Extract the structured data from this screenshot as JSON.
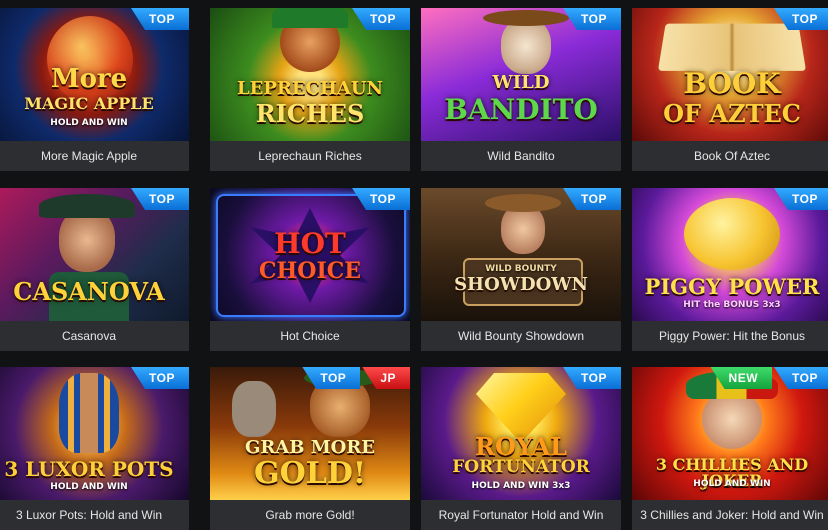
{
  "games": [
    {
      "name": "More Magic Apple",
      "art_lines": [
        "More",
        "MAGIC APPLE"
      ],
      "art_sub": "HOLD AND WIN",
      "badges": [
        {
          "label": "TOP",
          "type": "top"
        }
      ]
    },
    {
      "name": "Leprechaun Riches",
      "art_lines": [
        "LEPRECHAUN",
        "RICHES"
      ],
      "art_sub": "",
      "badges": [
        {
          "label": "TOP",
          "type": "top"
        }
      ]
    },
    {
      "name": "Wild Bandito",
      "art_lines": [
        "WILD",
        "BANDITO"
      ],
      "art_sub": "",
      "badges": [
        {
          "label": "TOP",
          "type": "top"
        }
      ]
    },
    {
      "name": "Book Of Aztec",
      "art_lines": [
        "BOOK",
        "OF AZTEC"
      ],
      "art_sub": "",
      "badges": [
        {
          "label": "TOP",
          "type": "top"
        }
      ]
    },
    {
      "name": "Casanova",
      "art_lines": [
        "CASANOVA"
      ],
      "art_sub": "",
      "badges": [
        {
          "label": "TOP",
          "type": "top"
        }
      ]
    },
    {
      "name": "Hot Choice",
      "art_lines": [
        "HOT",
        "CHOICE"
      ],
      "art_sub": "",
      "badges": [
        {
          "label": "TOP",
          "type": "top"
        }
      ]
    },
    {
      "name": "Wild Bounty Showdown",
      "art_lines": [
        "WILD BOUNTY",
        "SHOWDOWN"
      ],
      "art_sub": "",
      "badges": [
        {
          "label": "TOP",
          "type": "top"
        }
      ]
    },
    {
      "name": "Piggy Power: Hit the Bonus",
      "art_lines": [
        "PIGGY POWER"
      ],
      "art_sub": "HIT the BONUS 3x3",
      "badges": [
        {
          "label": "TOP",
          "type": "top"
        }
      ]
    },
    {
      "name": "3 Luxor Pots: Hold and Win",
      "art_lines": [
        "3 LUXOR POTS"
      ],
      "art_sub": "HOLD AND WIN",
      "badges": [
        {
          "label": "TOP",
          "type": "top"
        }
      ]
    },
    {
      "name": "Grab more Gold!",
      "art_lines": [
        "GRAB MORE",
        "GOLD!"
      ],
      "art_sub": "",
      "badges": [
        {
          "label": "TOP",
          "type": "top"
        },
        {
          "label": "JP",
          "type": "jp"
        }
      ]
    },
    {
      "name": "Royal Fortunator Hold and Win",
      "art_lines": [
        "ROYAL",
        "FORTUNATOR"
      ],
      "art_sub": "HOLD AND WIN 3x3",
      "badges": [
        {
          "label": "TOP",
          "type": "top"
        }
      ]
    },
    {
      "name": "3 Chillies and Joker: Hold and Win",
      "art_lines": [
        "3 CHILLIES AND JOKER"
      ],
      "art_sub": "HOLD AND WIN",
      "badges": [
        {
          "label": "NEW",
          "type": "new"
        },
        {
          "label": "TOP",
          "type": "top"
        }
      ]
    }
  ]
}
